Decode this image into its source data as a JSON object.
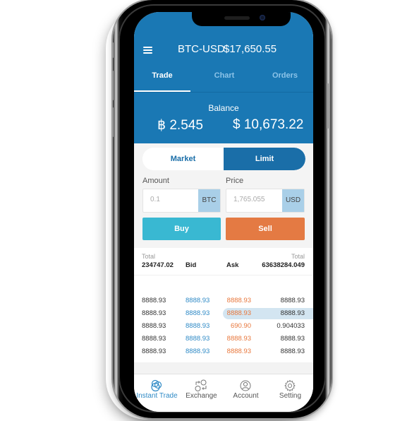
{
  "header": {
    "pair": "BTC-USD",
    "price": "$17,650.55",
    "menu_icon": "hamburger-menu-icon"
  },
  "tabs": [
    {
      "label": "Trade",
      "active": true
    },
    {
      "label": "Chart",
      "active": false
    },
    {
      "label": "Orders",
      "active": false
    }
  ],
  "balance": {
    "label": "Balance",
    "btc": "฿ 2.545",
    "usd": "$ 10,673.22"
  },
  "order_type": {
    "options": [
      "Market",
      "Limit"
    ],
    "selected": "Limit"
  },
  "amount": {
    "label": "Amount",
    "value": "0.1",
    "unit": "BTC"
  },
  "price_field": {
    "label": "Price",
    "value": "1,765.055",
    "unit": "USD"
  },
  "actions": {
    "buy": "Buy",
    "sell": "Sell"
  },
  "colors": {
    "primary": "#1a78b4",
    "buy": "#39b8d2",
    "sell": "#e47a43",
    "bid_text": "#2f8ac6",
    "ask_text": "#e8773c"
  },
  "order_book": {
    "total_label_left": "Total",
    "total_label_right": "Total",
    "total_left": "234747.02",
    "bid_header": "Bid",
    "ask_header": "Ask",
    "total_right": "63638284.049",
    "rows": [
      {
        "total": "8888.93",
        "bid": "8888.93",
        "ask": "8888.93",
        "amount": "8888.93",
        "highlighted": false
      },
      {
        "total": "8888.93",
        "bid": "8888.93",
        "ask": "8888.93",
        "amount": "8888.93",
        "highlighted": true
      },
      {
        "total": "8888.93",
        "bid": "8888.93",
        "ask": "690.90",
        "amount": "0.904033",
        "highlighted": false
      },
      {
        "total": "8888.93",
        "bid": "8888.93",
        "ask": "8888.93",
        "amount": "8888.93",
        "highlighted": false
      },
      {
        "total": "8888.93",
        "bid": "8888.93",
        "ask": "8888.93",
        "amount": "8888.93",
        "highlighted": false
      }
    ]
  },
  "bottom_nav": [
    {
      "label": "Instant Trade",
      "icon": "instant-trade-icon",
      "active": true
    },
    {
      "label": "Exchange",
      "icon": "exchange-icon",
      "active": false
    },
    {
      "label": "Account",
      "icon": "account-icon",
      "active": false
    },
    {
      "label": "Setting",
      "icon": "gear-icon",
      "active": false
    }
  ]
}
